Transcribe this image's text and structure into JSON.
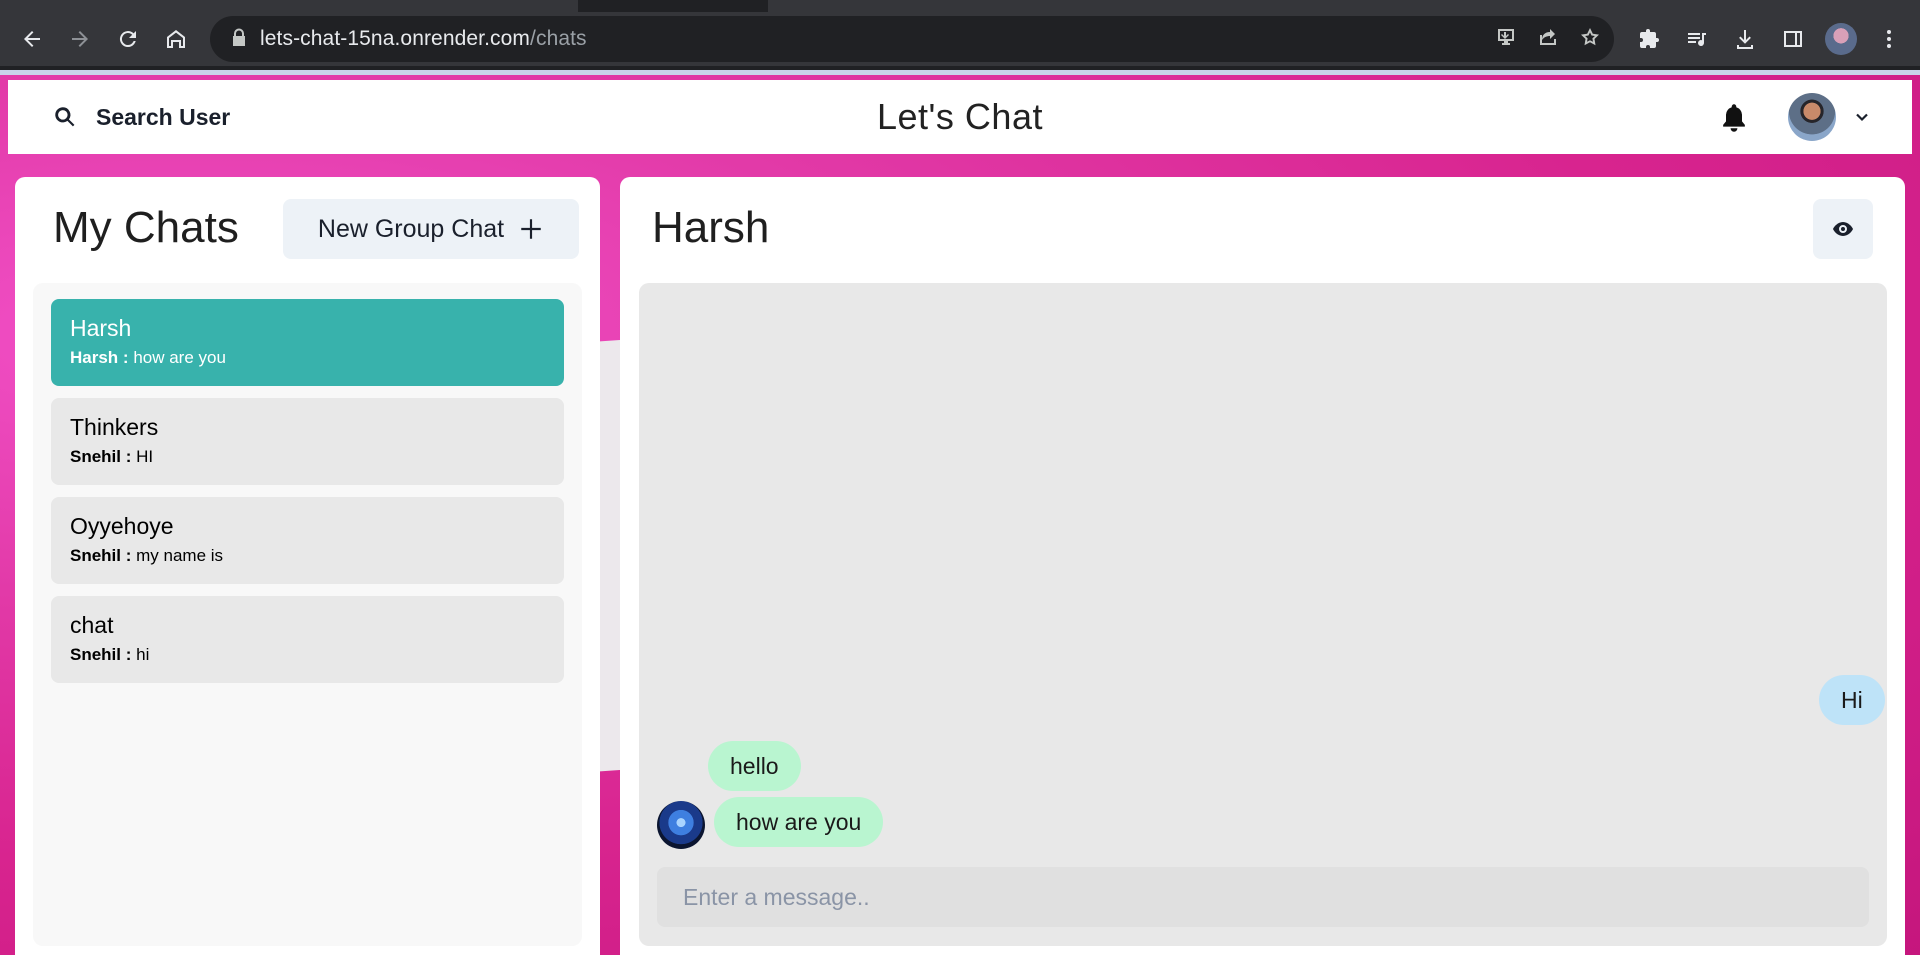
{
  "browser": {
    "url_host": "lets-chat-15na.onrender.com",
    "url_path": "/chats",
    "icons": [
      "back-icon",
      "forward-icon",
      "reload-icon",
      "home-icon",
      "lock-icon",
      "install-icon",
      "share-icon",
      "star-icon",
      "extensions-icon",
      "media-icon",
      "downloads-icon",
      "sidepanel-icon",
      "profile-icon",
      "menu-icon"
    ]
  },
  "header": {
    "search_label": "Search User",
    "brand": "Let's Chat"
  },
  "sidebar": {
    "title": "My Chats",
    "new_group_label": "New Group Chat",
    "chats": [
      {
        "name": "Harsh",
        "sender": "Harsh :",
        "message": "how are you",
        "active": true
      },
      {
        "name": "Thinkers",
        "sender": "Snehil :",
        "message": "HI",
        "active": false
      },
      {
        "name": "Oyyehoye",
        "sender": "Snehil :",
        "message": "my name is",
        "active": false
      },
      {
        "name": "chat",
        "sender": "Snehil :",
        "message": "hi",
        "active": false
      }
    ]
  },
  "conversation": {
    "title": "Harsh",
    "messages": [
      {
        "text": "Hi",
        "direction": "out"
      },
      {
        "text": "hello",
        "direction": "in"
      },
      {
        "text": "how are you",
        "direction": "in"
      }
    ],
    "input_placeholder": "Enter a message.."
  },
  "colors": {
    "active_chat": "#38b2ac",
    "outgoing_bubble": "#bee3f8",
    "incoming_bubble": "#b9f5d0",
    "background": "#e23aa8"
  }
}
